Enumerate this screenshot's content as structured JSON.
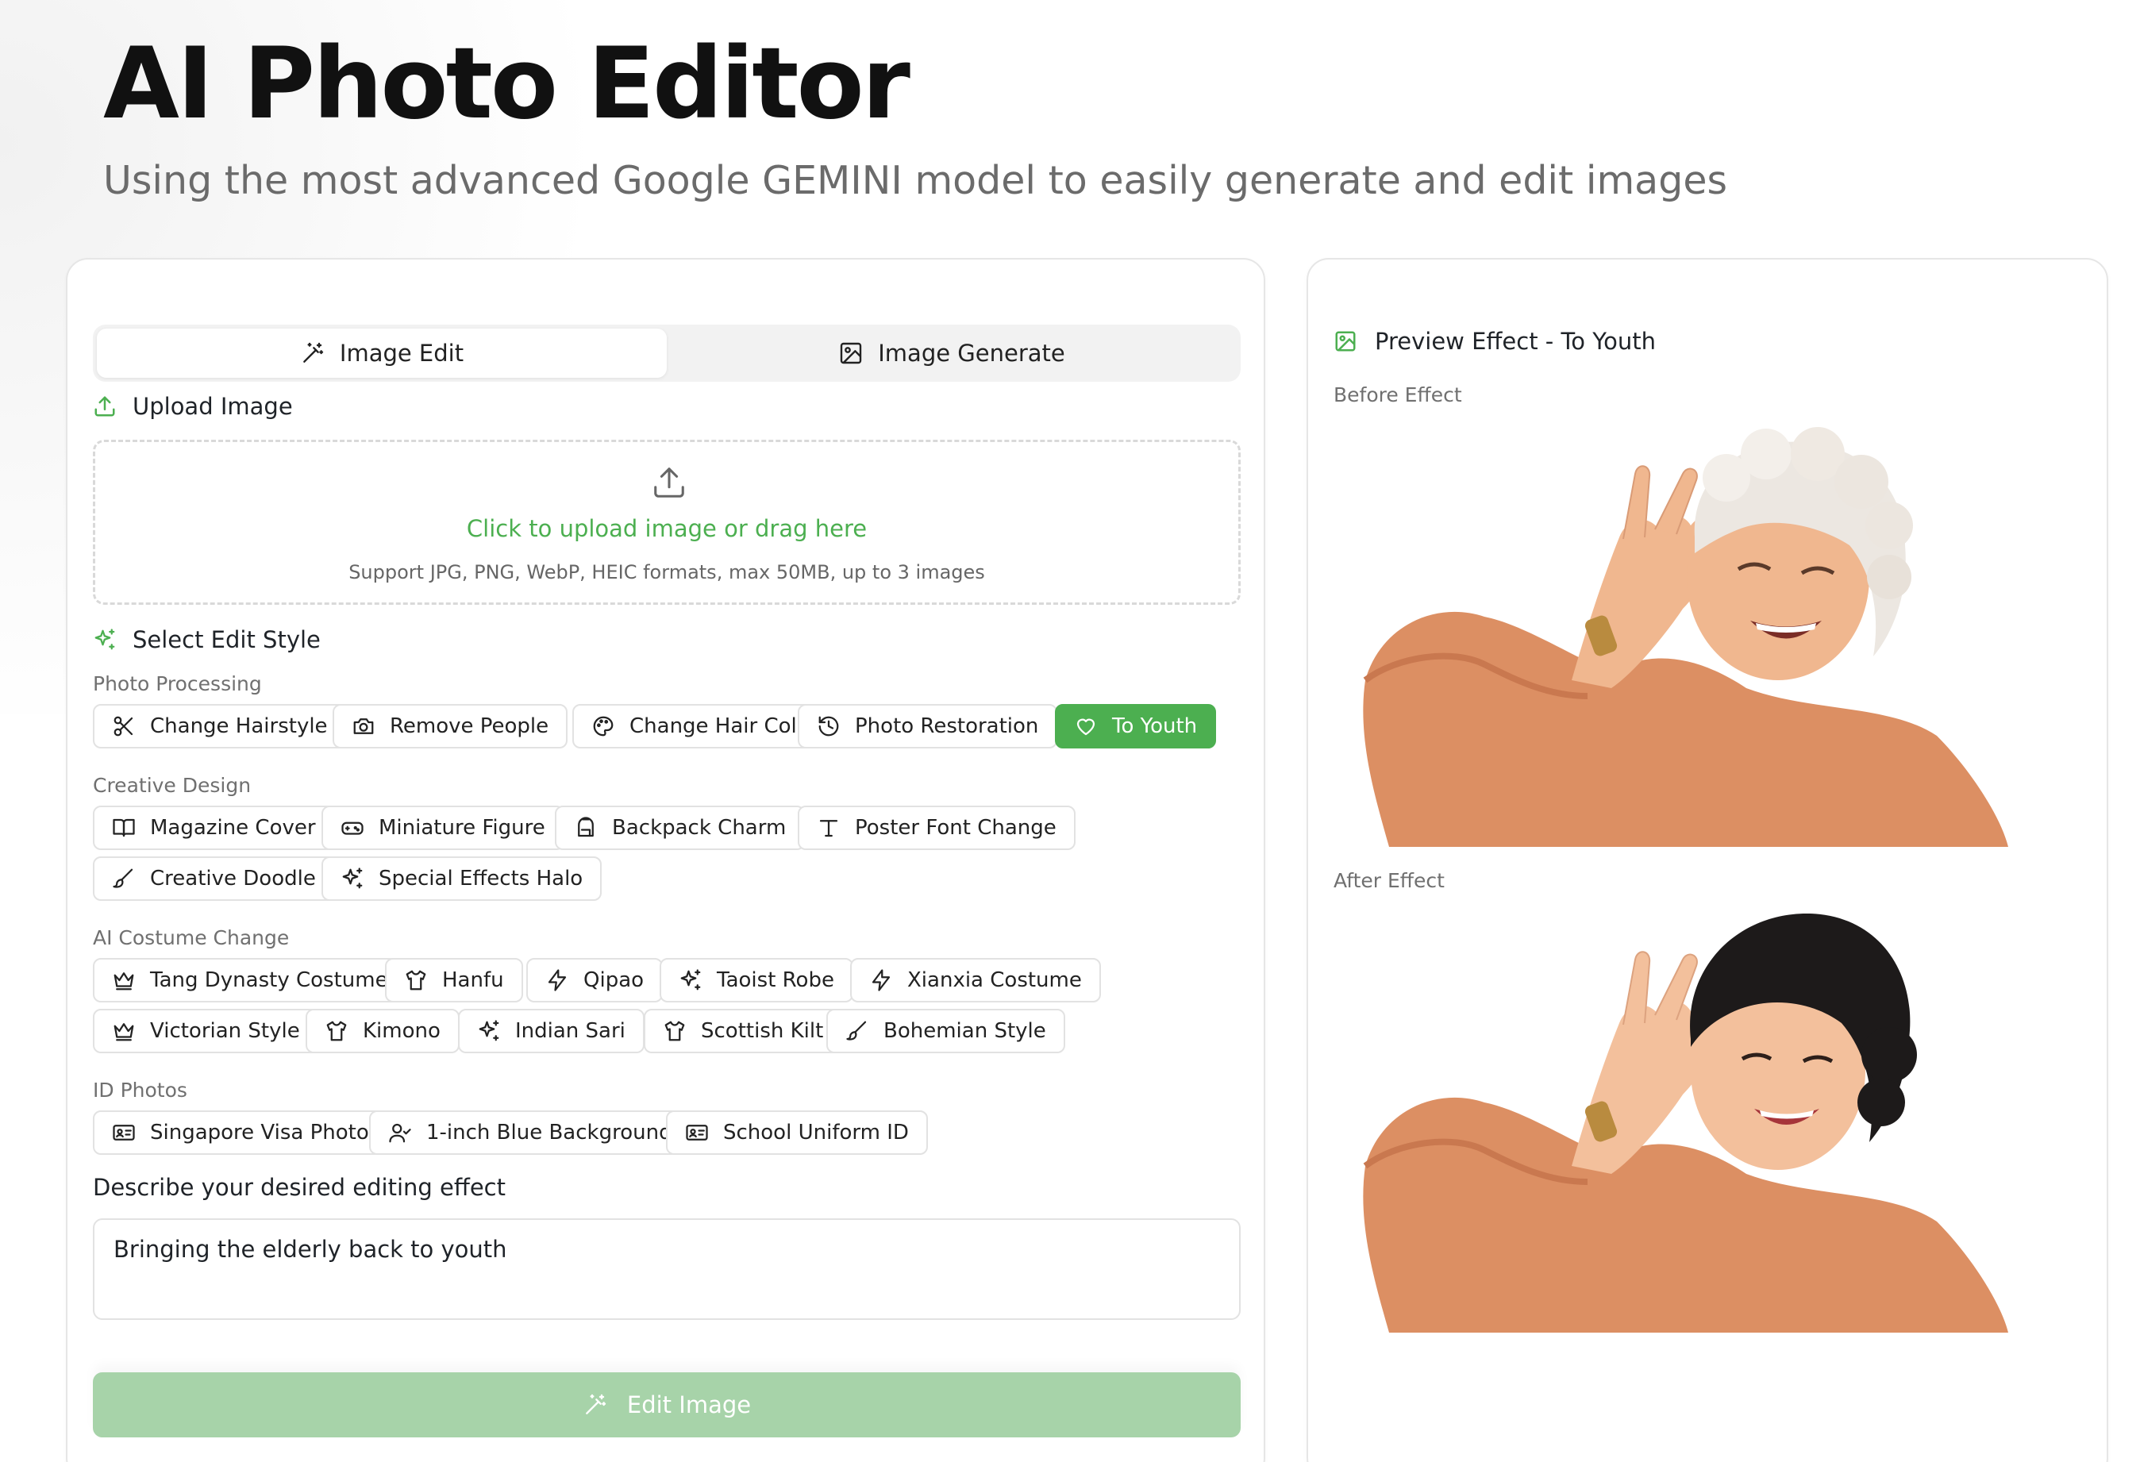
{
  "header": {
    "title": "AI Photo Editor",
    "subtitle": "Using the most advanced Google GEMINI model to easily generate and edit images"
  },
  "tabs": [
    {
      "label": "Image Edit",
      "icon": "magic-wand-icon",
      "active": true
    },
    {
      "label": "Image Generate",
      "icon": "image-icon",
      "active": false
    }
  ],
  "upload": {
    "title": "Upload Image",
    "prompt": "Click to upload image or drag here",
    "hint": "Support JPG, PNG, WebP, HEIC formats, max 50MB, up to 3 images"
  },
  "styles": {
    "title": "Select Edit Style",
    "groups": [
      {
        "label": "Photo Processing",
        "items": [
          {
            "label": "Change Hairstyle",
            "icon": "scissors-icon"
          },
          {
            "label": "Remove People",
            "icon": "camera-icon"
          },
          {
            "label": "Change Hair Color",
            "icon": "palette-icon"
          },
          {
            "label": "Photo Restoration",
            "icon": "history-icon"
          },
          {
            "label": "To Youth",
            "icon": "heart-icon",
            "selected": true
          }
        ]
      },
      {
        "label": "Creative Design",
        "items": [
          {
            "label": "Magazine Cover",
            "icon": "book-icon"
          },
          {
            "label": "Miniature Figure",
            "icon": "gamepad-icon"
          },
          {
            "label": "Backpack Charm",
            "icon": "backpack-icon"
          },
          {
            "label": "Poster Font Change",
            "icon": "type-icon"
          },
          {
            "label": "Creative Doodle",
            "icon": "brush-icon"
          },
          {
            "label": "Special Effects Halo",
            "icon": "sparkles-icon"
          }
        ]
      },
      {
        "label": "AI Costume Change",
        "items": [
          {
            "label": "Tang Dynasty Costume",
            "icon": "crown-icon"
          },
          {
            "label": "Hanfu",
            "icon": "shirt-icon"
          },
          {
            "label": "Qipao",
            "icon": "zap-icon"
          },
          {
            "label": "Taoist Robe",
            "icon": "sparkles-icon"
          },
          {
            "label": "Xianxia Costume",
            "icon": "zap-icon"
          },
          {
            "label": "Victorian Style",
            "icon": "crown-icon"
          },
          {
            "label": "Kimono",
            "icon": "shirt-icon"
          },
          {
            "label": "Indian Sari",
            "icon": "sparkles-icon"
          },
          {
            "label": "Scottish Kilt",
            "icon": "shirt-icon"
          },
          {
            "label": "Bohemian Style",
            "icon": "brush-icon"
          }
        ]
      },
      {
        "label": "ID Photos",
        "items": [
          {
            "label": "Singapore Visa Photo",
            "icon": "id-card-icon"
          },
          {
            "label": "1-inch Blue Background",
            "icon": "user-check-icon"
          },
          {
            "label": "School Uniform ID",
            "icon": "id-card-icon"
          }
        ]
      }
    ]
  },
  "describe": {
    "label": "Describe your desired editing effect",
    "value": "Bringing the elderly back to youth"
  },
  "edit_button": {
    "label": "Edit Image",
    "icon": "magic-wand-icon"
  },
  "preview": {
    "title": "Preview Effect - To Youth",
    "before_label": "Before Effect",
    "after_label": "After Effect"
  },
  "colors": {
    "accent": "#4caf50",
    "accent_disabled": "#a7d3a9",
    "skin": "#f0b78f",
    "sweater": "#dc8f63"
  }
}
